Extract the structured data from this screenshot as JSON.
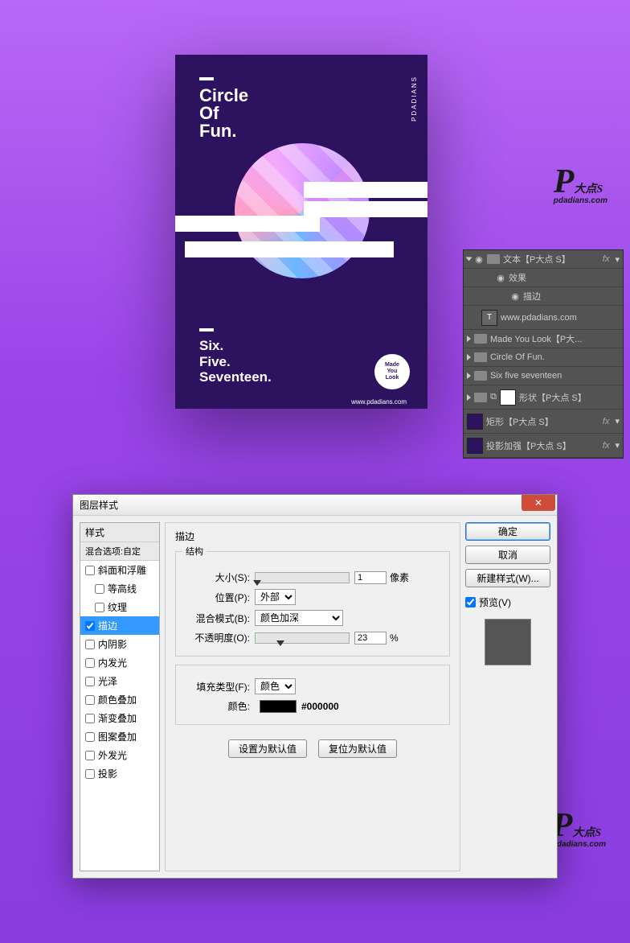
{
  "poster": {
    "title_lines": [
      "Circle",
      "Of",
      "Fun."
    ],
    "subtitle_lines": [
      "Six.",
      "Five.",
      "Seventeen."
    ],
    "badge_text": "Made\nYou\nLook",
    "site": "www.pdadians.com",
    "sidebadge": "PDADIANS"
  },
  "watermark": {
    "logo_big": "P",
    "logo_small": "大点S",
    "url": "pdadians.com"
  },
  "layers": {
    "items": [
      {
        "name": "文本【P大点 S】",
        "fx": true,
        "type": "folder",
        "open": true
      },
      {
        "name": "效果",
        "type": "fx-head",
        "indent": 2
      },
      {
        "name": "描边",
        "type": "fx-sub",
        "indent": 3
      },
      {
        "name": "www.pdadians.com",
        "type": "text",
        "indent": 1
      },
      {
        "name": "Made You Look【P大...",
        "type": "folder",
        "indent": 1
      },
      {
        "name": "Circle Of Fun.",
        "type": "folder",
        "indent": 1
      },
      {
        "name": "Six five seventeen",
        "type": "folder",
        "indent": 1
      },
      {
        "name": "形状【P大点 S】",
        "type": "shape-group"
      },
      {
        "name": "矩形【P大点 S】",
        "type": "layer",
        "fx": true
      },
      {
        "name": "投影加强【P大点 S】",
        "type": "layer",
        "fx": true
      }
    ]
  },
  "dialog": {
    "title": "图层样式",
    "ok": "确定",
    "cancel": "取消",
    "newstyle": "新建样式(W)...",
    "preview_label": "预览(V)",
    "styles": {
      "header": "样式",
      "blend": "混合选项:自定",
      "items": [
        {
          "label": "斜面和浮雕",
          "checked": false
        },
        {
          "label": "等高线",
          "checked": false,
          "indent": true
        },
        {
          "label": "纹理",
          "checked": false,
          "indent": true
        },
        {
          "label": "描边",
          "checked": true,
          "selected": true
        },
        {
          "label": "内阴影",
          "checked": false
        },
        {
          "label": "内发光",
          "checked": false
        },
        {
          "label": "光泽",
          "checked": false
        },
        {
          "label": "颜色叠加",
          "checked": false
        },
        {
          "label": "渐变叠加",
          "checked": false
        },
        {
          "label": "图案叠加",
          "checked": false
        },
        {
          "label": "外发光",
          "checked": false
        },
        {
          "label": "投影",
          "checked": false
        }
      ]
    },
    "stroke": {
      "title": "描边",
      "group1": "结构",
      "size_label": "大小(S):",
      "size_value": "1",
      "size_unit": "像素",
      "position_label": "位置(P):",
      "position_value": "外部",
      "blend_label": "混合模式(B):",
      "blend_value": "颜色加深",
      "opacity_label": "不透明度(O):",
      "opacity_value": "23",
      "opacity_unit": "%",
      "fill_label": "填充类型(F):",
      "fill_value": "颜色",
      "color_label": "颜色:",
      "color_hex": "#000000",
      "set_default": "设置为默认值",
      "reset_default": "复位为默认值"
    }
  }
}
